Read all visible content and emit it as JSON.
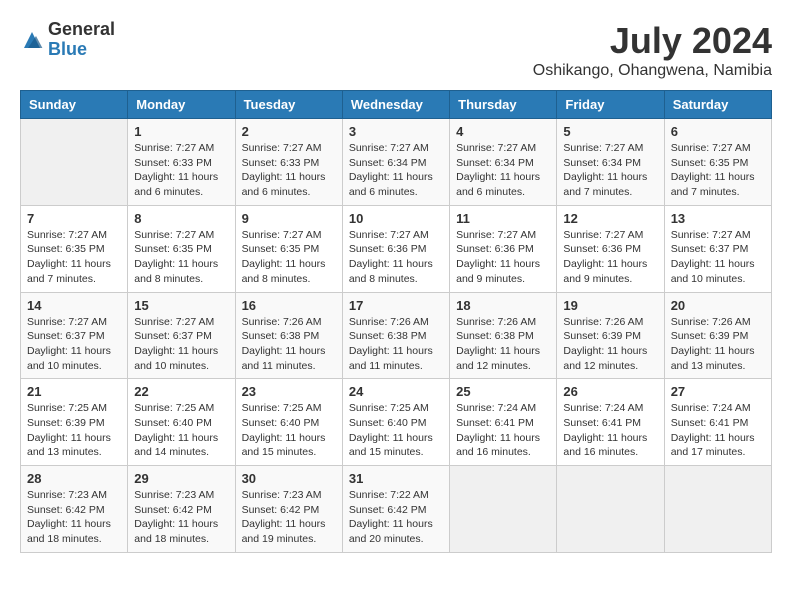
{
  "logo": {
    "general": "General",
    "blue": "Blue"
  },
  "title": "July 2024",
  "location": "Oshikango, Ohangwena, Namibia",
  "days_of_week": [
    "Sunday",
    "Monday",
    "Tuesday",
    "Wednesday",
    "Thursday",
    "Friday",
    "Saturday"
  ],
  "weeks": [
    [
      {
        "day": "",
        "info": ""
      },
      {
        "day": "1",
        "info": "Sunrise: 7:27 AM\nSunset: 6:33 PM\nDaylight: 11 hours and 6 minutes."
      },
      {
        "day": "2",
        "info": "Sunrise: 7:27 AM\nSunset: 6:33 PM\nDaylight: 11 hours and 6 minutes."
      },
      {
        "day": "3",
        "info": "Sunrise: 7:27 AM\nSunset: 6:34 PM\nDaylight: 11 hours and 6 minutes."
      },
      {
        "day": "4",
        "info": "Sunrise: 7:27 AM\nSunset: 6:34 PM\nDaylight: 11 hours and 6 minutes."
      },
      {
        "day": "5",
        "info": "Sunrise: 7:27 AM\nSunset: 6:34 PM\nDaylight: 11 hours and 7 minutes."
      },
      {
        "day": "6",
        "info": "Sunrise: 7:27 AM\nSunset: 6:35 PM\nDaylight: 11 hours and 7 minutes."
      }
    ],
    [
      {
        "day": "7",
        "info": "Sunrise: 7:27 AM\nSunset: 6:35 PM\nDaylight: 11 hours and 7 minutes."
      },
      {
        "day": "8",
        "info": "Sunrise: 7:27 AM\nSunset: 6:35 PM\nDaylight: 11 hours and 8 minutes."
      },
      {
        "day": "9",
        "info": "Sunrise: 7:27 AM\nSunset: 6:35 PM\nDaylight: 11 hours and 8 minutes."
      },
      {
        "day": "10",
        "info": "Sunrise: 7:27 AM\nSunset: 6:36 PM\nDaylight: 11 hours and 8 minutes."
      },
      {
        "day": "11",
        "info": "Sunrise: 7:27 AM\nSunset: 6:36 PM\nDaylight: 11 hours and 9 minutes."
      },
      {
        "day": "12",
        "info": "Sunrise: 7:27 AM\nSunset: 6:36 PM\nDaylight: 11 hours and 9 minutes."
      },
      {
        "day": "13",
        "info": "Sunrise: 7:27 AM\nSunset: 6:37 PM\nDaylight: 11 hours and 10 minutes."
      }
    ],
    [
      {
        "day": "14",
        "info": "Sunrise: 7:27 AM\nSunset: 6:37 PM\nDaylight: 11 hours and 10 minutes."
      },
      {
        "day": "15",
        "info": "Sunrise: 7:27 AM\nSunset: 6:37 PM\nDaylight: 11 hours and 10 minutes."
      },
      {
        "day": "16",
        "info": "Sunrise: 7:26 AM\nSunset: 6:38 PM\nDaylight: 11 hours and 11 minutes."
      },
      {
        "day": "17",
        "info": "Sunrise: 7:26 AM\nSunset: 6:38 PM\nDaylight: 11 hours and 11 minutes."
      },
      {
        "day": "18",
        "info": "Sunrise: 7:26 AM\nSunset: 6:38 PM\nDaylight: 11 hours and 12 minutes."
      },
      {
        "day": "19",
        "info": "Sunrise: 7:26 AM\nSunset: 6:39 PM\nDaylight: 11 hours and 12 minutes."
      },
      {
        "day": "20",
        "info": "Sunrise: 7:26 AM\nSunset: 6:39 PM\nDaylight: 11 hours and 13 minutes."
      }
    ],
    [
      {
        "day": "21",
        "info": "Sunrise: 7:25 AM\nSunset: 6:39 PM\nDaylight: 11 hours and 13 minutes."
      },
      {
        "day": "22",
        "info": "Sunrise: 7:25 AM\nSunset: 6:40 PM\nDaylight: 11 hours and 14 minutes."
      },
      {
        "day": "23",
        "info": "Sunrise: 7:25 AM\nSunset: 6:40 PM\nDaylight: 11 hours and 15 minutes."
      },
      {
        "day": "24",
        "info": "Sunrise: 7:25 AM\nSunset: 6:40 PM\nDaylight: 11 hours and 15 minutes."
      },
      {
        "day": "25",
        "info": "Sunrise: 7:24 AM\nSunset: 6:41 PM\nDaylight: 11 hours and 16 minutes."
      },
      {
        "day": "26",
        "info": "Sunrise: 7:24 AM\nSunset: 6:41 PM\nDaylight: 11 hours and 16 minutes."
      },
      {
        "day": "27",
        "info": "Sunrise: 7:24 AM\nSunset: 6:41 PM\nDaylight: 11 hours and 17 minutes."
      }
    ],
    [
      {
        "day": "28",
        "info": "Sunrise: 7:23 AM\nSunset: 6:42 PM\nDaylight: 11 hours and 18 minutes."
      },
      {
        "day": "29",
        "info": "Sunrise: 7:23 AM\nSunset: 6:42 PM\nDaylight: 11 hours and 18 minutes."
      },
      {
        "day": "30",
        "info": "Sunrise: 7:23 AM\nSunset: 6:42 PM\nDaylight: 11 hours and 19 minutes."
      },
      {
        "day": "31",
        "info": "Sunrise: 7:22 AM\nSunset: 6:42 PM\nDaylight: 11 hours and 20 minutes."
      },
      {
        "day": "",
        "info": ""
      },
      {
        "day": "",
        "info": ""
      },
      {
        "day": "",
        "info": ""
      }
    ]
  ]
}
